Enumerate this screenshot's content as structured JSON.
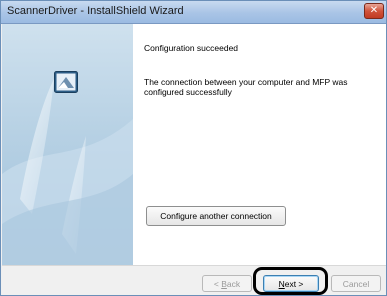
{
  "window": {
    "title": "ScannerDriver - InstallShield Wizard",
    "close_symbol": "✕"
  },
  "panel": {
    "icon": "installer-icon"
  },
  "content": {
    "heading": "Configuration succeeded",
    "message": "The connection between your computer and MFP was configured successfully",
    "configure_button_label": "Configure another connection"
  },
  "footer": {
    "back_prefix": "< ",
    "back_key": "B",
    "back_rest": "ack",
    "next_key": "N",
    "next_rest": "ext >",
    "cancel_label": "Cancel"
  },
  "colors": {
    "accent": "#3c7fb1",
    "close_red": "#c13a22"
  }
}
